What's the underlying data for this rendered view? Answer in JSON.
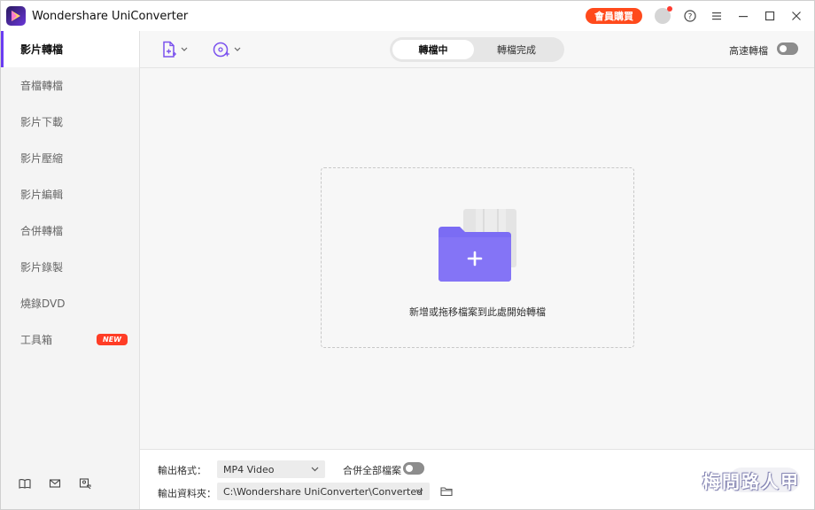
{
  "app": {
    "title": "Wondershare UniConverter",
    "member_button": "會員購買"
  },
  "sidebar": {
    "items": [
      {
        "label": "影片轉檔",
        "active": true
      },
      {
        "label": "音檔轉檔"
      },
      {
        "label": "影片下載"
      },
      {
        "label": "影片壓縮"
      },
      {
        "label": "影片編輯"
      },
      {
        "label": "合併轉檔"
      },
      {
        "label": "影片錄製"
      },
      {
        "label": "燒錄DVD"
      },
      {
        "label": "工具箱",
        "badge": "NEW"
      }
    ],
    "footer_icons": [
      "book-icon",
      "mail-icon",
      "user-feedback-icon"
    ]
  },
  "toolbar": {
    "tabs": [
      {
        "label": "轉檔中",
        "active": true
      },
      {
        "label": "轉檔完成"
      }
    ],
    "high_speed_label": "高速轉檔",
    "high_speed_on": false
  },
  "dropzone": {
    "hint": "新增或拖移檔案到此處開始轉檔"
  },
  "bottom": {
    "output_format_label": "輸出格式：",
    "output_format_value": "MP4 Video",
    "merge_label": "合併全部檔案",
    "merge_on": false,
    "output_folder_label": "輸出資料夾：",
    "output_folder_value": "C:\\Wondershare UniConverter\\Converted",
    "watermark": "梅問路人甲"
  },
  "colors": {
    "accent": "#6a3cf2",
    "member": "#ff4a1c",
    "new_badge": "#ff3d26"
  }
}
